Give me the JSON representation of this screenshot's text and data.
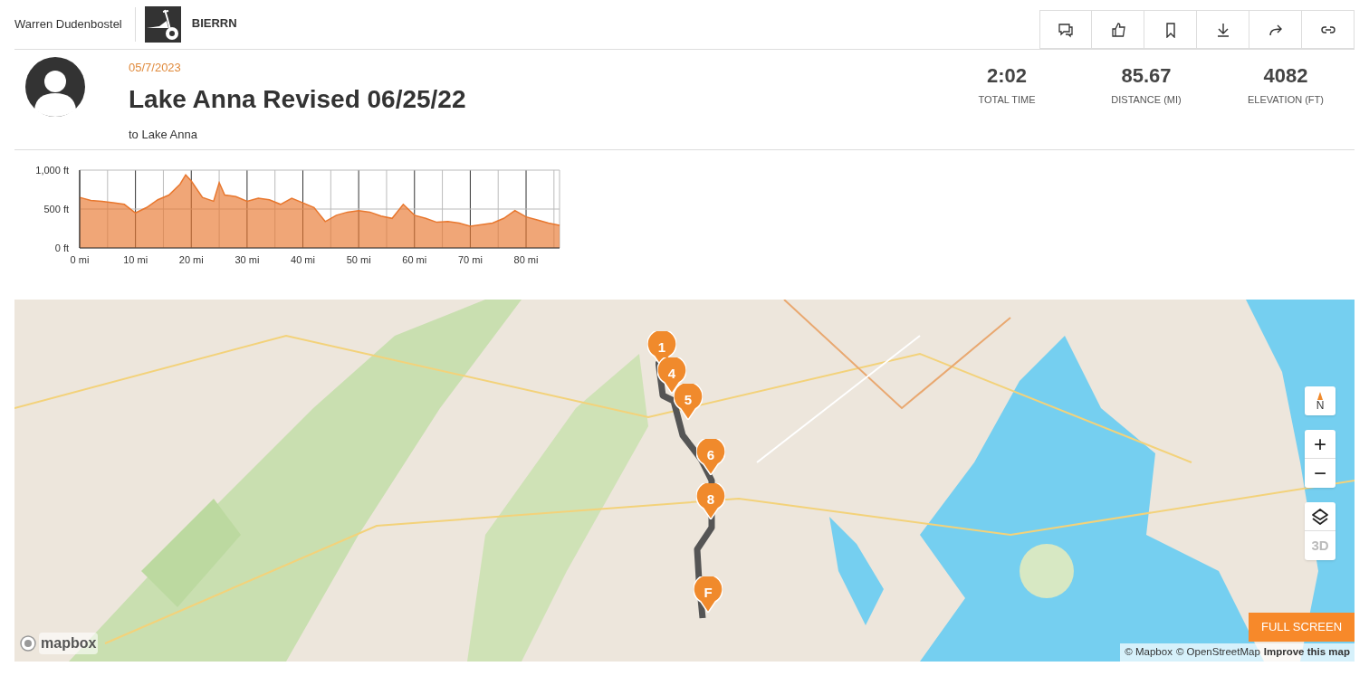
{
  "header": {
    "user_name": "Warren Dudenbostel",
    "bike_name": "BIERRN",
    "actions": [
      {
        "kind": "comment"
      },
      {
        "kind": "like"
      },
      {
        "kind": "bookmark"
      },
      {
        "kind": "download"
      },
      {
        "kind": "share"
      },
      {
        "kind": "link"
      }
    ]
  },
  "ride": {
    "date": "05/7/2023",
    "title": "Lake Anna Revised 06/25/22",
    "subtitle": "to Lake Anna"
  },
  "stats": [
    {
      "value": "2:02",
      "label": "TOTAL TIME"
    },
    {
      "value": "85.67",
      "label": "DISTANCE (MI)"
    },
    {
      "value": "4082",
      "label": "ELEVATION (FT)"
    }
  ],
  "elevation": {
    "chart_data": {
      "type": "area",
      "x": [
        0,
        2,
        4,
        6,
        8,
        10,
        12,
        14,
        16,
        18,
        19,
        20,
        22,
        24,
        25,
        26,
        28,
        30,
        32,
        34,
        36,
        38,
        40,
        42,
        44,
        46,
        48,
        50,
        52,
        54,
        56,
        58,
        60,
        62,
        64,
        66,
        68,
        70,
        72,
        74,
        76,
        78,
        80,
        82,
        84,
        86
      ],
      "grid": true,
      "series": [
        {
          "color": "#e8772e",
          "values": [
            650,
            610,
            600,
            580,
            560,
            450,
            520,
            620,
            680,
            820,
            940,
            860,
            650,
            600,
            840,
            680,
            660,
            600,
            640,
            620,
            560,
            640,
            580,
            520,
            340,
            420,
            460,
            480,
            460,
            410,
            380,
            560,
            420,
            380,
            330,
            340,
            320,
            280,
            300,
            320,
            380,
            480,
            400,
            360,
            320,
            290
          ]
        }
      ],
      "xlim": [
        0,
        86
      ],
      "ylim": [
        0,
        1000
      ],
      "xticks": [
        {
          "value": 0,
          "label": "0 mi"
        },
        {
          "value": 10,
          "label": "10 mi"
        },
        {
          "value": 20,
          "label": "20 mi"
        },
        {
          "value": 30,
          "label": "30 mi"
        },
        {
          "value": 40,
          "label": "40 mi"
        },
        {
          "value": 50,
          "label": "50 mi"
        },
        {
          "value": 60,
          "label": "60 mi"
        },
        {
          "value": 70,
          "label": "70 mi"
        },
        {
          "value": 80,
          "label": "80 mi"
        }
      ],
      "yticks": [
        {
          "value": 0,
          "label": "0 ft"
        },
        {
          "value": 500,
          "label": "500 ft"
        },
        {
          "value": 1000,
          "label": "1,000 ft"
        }
      ]
    }
  },
  "map": {
    "markers": [
      {
        "label": "1"
      },
      {
        "label": "4"
      },
      {
        "label": "5"
      },
      {
        "label": "6"
      },
      {
        "label": "8"
      },
      {
        "label": "F"
      }
    ],
    "compass": "N",
    "zoom_in": "+",
    "zoom_out": "−",
    "three_d": "3D",
    "full_screen": "FULL SCREEN",
    "logo": "mapbox",
    "attribution": [
      {
        "text": "© Mapbox",
        "kind": "link"
      },
      {
        "text": "© OpenStreetMap",
        "kind": "link"
      },
      {
        "text": "Improve this map",
        "kind": "strong"
      }
    ]
  }
}
